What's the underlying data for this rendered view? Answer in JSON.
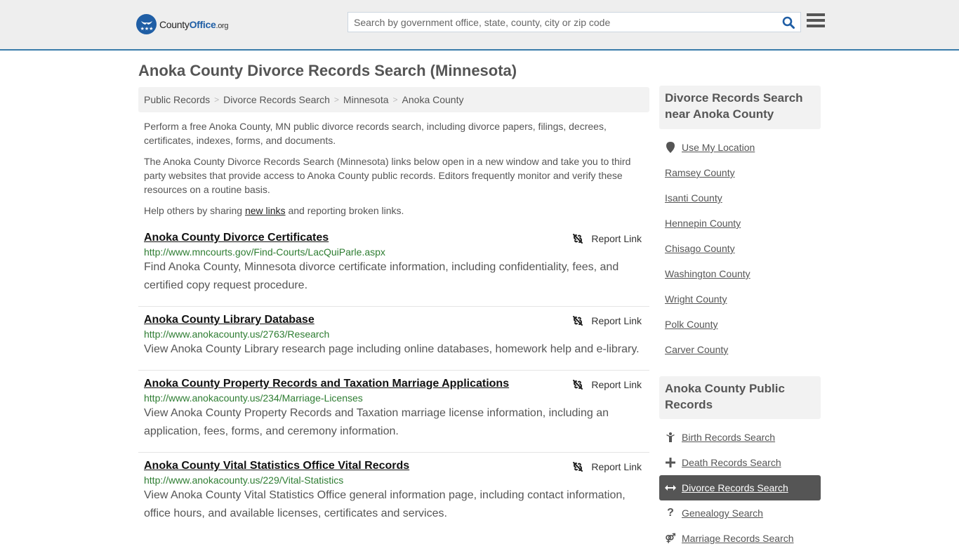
{
  "header": {
    "logo": {
      "county": "County",
      "office": "Office",
      "org": ".org"
    },
    "search": {
      "placeholder": "Search by government office, state, county, city or zip code",
      "value": ""
    },
    "brand_color": "#1f5ea5",
    "border_color": "#3a7caa"
  },
  "page": {
    "title": "Anoka County Divorce Records Search (Minnesota)"
  },
  "breadcrumb": [
    {
      "label": "Public Records"
    },
    {
      "label": "Divorce Records Search"
    },
    {
      "label": "Minnesota"
    },
    {
      "label": "Anoka County"
    }
  ],
  "intro": {
    "p1": "Perform a free Anoka County, MN public divorce records search, including divorce papers, filings, decrees, certificates, indexes, forms, and documents.",
    "p2": "The Anoka County Divorce Records Search (Minnesota) links below open in a new window and take you to third party websites that provide access to Anoka County public records. Editors frequently monitor and verify these resources on a routine basis.",
    "p3_before": "Help others by sharing ",
    "p3_link": "new links",
    "p3_after": " and reporting broken links."
  },
  "report_label": "Report Link",
  "results": [
    {
      "title": "Anoka County Divorce Certificates",
      "url": "http://www.mncourts.gov/Find-Courts/LacQuiParle.aspx",
      "description": "Find Anoka County, Minnesota divorce certificate information, including confidentiality, fees, and certified copy request procedure."
    },
    {
      "title": "Anoka County Library Database",
      "url": "http://www.anokacounty.us/2763/Research",
      "description": "View Anoka County Library research page including online databases, homework help and e-library."
    },
    {
      "title": "Anoka County Property Records and Taxation Marriage Applications",
      "url": "http://www.anokacounty.us/234/Marriage-Licenses",
      "description": "View Anoka County Property Records and Taxation marriage license information, including an application, fees, forms, and ceremony information."
    },
    {
      "title": "Anoka County Vital Statistics Office Vital Records",
      "url": "http://www.anokacounty.us/229/Vital-Statistics",
      "description": "View Anoka County Vital Statistics Office general information page, including contact information, office hours, and available licenses, certificates and services."
    }
  ],
  "sidebar": {
    "nearby": {
      "title": "Divorce Records Search near Anoka County",
      "use_location": "Use My Location",
      "counties": [
        "Ramsey County",
        "Isanti County",
        "Hennepin County",
        "Chisago County",
        "Washington County",
        "Wright County",
        "Polk County",
        "Carver County"
      ]
    },
    "public_records": {
      "title": "Anoka County Public Records",
      "items": [
        {
          "label": "Birth Records Search",
          "icon": "child-icon"
        },
        {
          "label": "Death Records Search",
          "icon": "plus-icon"
        },
        {
          "label": "Divorce Records Search",
          "icon": "arrows-horizontal-icon",
          "active": true
        },
        {
          "label": "Genealogy Search",
          "icon": "question-icon"
        },
        {
          "label": "Marriage Records Search",
          "icon": "gender-icon"
        }
      ]
    }
  }
}
